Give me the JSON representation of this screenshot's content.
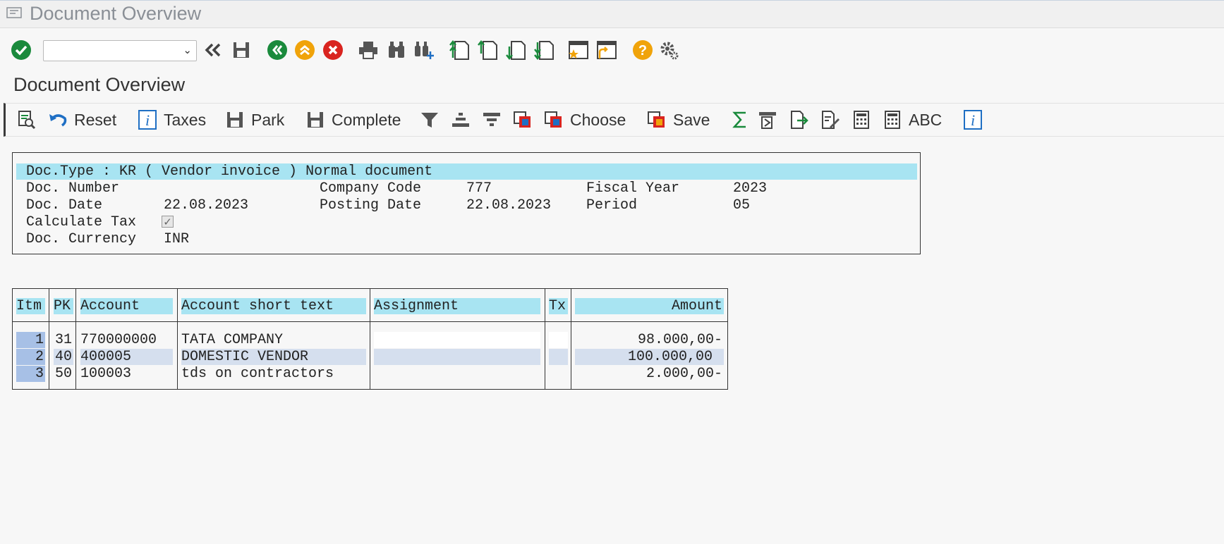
{
  "window": {
    "title": "Document Overview"
  },
  "toolbar": {
    "command_field": {
      "value": "",
      "placeholder": ""
    },
    "icons": [
      "enter-icon",
      "back-icon",
      "save-icon",
      "back-green-icon",
      "exit-icon",
      "cancel-icon",
      "print-icon",
      "find-icon",
      "find-next-icon",
      "first-page-icon",
      "previous-page-icon",
      "next-page-icon",
      "last-page-icon",
      "new-session-icon",
      "shortcut-icon",
      "help-icon",
      "settings-icon"
    ]
  },
  "page": {
    "subtitle": "Document Overview"
  },
  "app_toolbar": {
    "reset": "Reset",
    "taxes": "Taxes",
    "park": "Park",
    "complete": "Complete",
    "choose": "Choose",
    "save": "Save",
    "abc": "ABC"
  },
  "header": {
    "doc_type_line": "Doc.Type : KR ( Vendor invoice ) Normal document",
    "doc_number_label": "Doc. Number",
    "doc_number": "",
    "company_code_label": "Company Code",
    "company_code": "777",
    "fiscal_year_label": "Fiscal Year",
    "fiscal_year": "2023",
    "doc_date_label": "Doc. Date",
    "doc_date": "22.08.2023",
    "posting_date_label": "Posting Date",
    "posting_date": "22.08.2023",
    "period_label": "Period",
    "period": "05",
    "calc_tax_label": "Calculate Tax",
    "calc_tax_checked": true,
    "calc_tax_mark": "✓",
    "currency_label": "Doc. Currency",
    "currency": "INR"
  },
  "items": {
    "columns": [
      "Itm",
      "PK",
      "Account",
      "Account short text",
      "Assignment",
      "Tx",
      "Amount"
    ],
    "rows": [
      {
        "itm": "1",
        "pk": "31",
        "account": "770000000",
        "text": "TATA COMPANY",
        "assignment": "",
        "tx": "",
        "amount": "98.000,00-"
      },
      {
        "itm": "2",
        "pk": "40",
        "account": "400005",
        "text": "DOMESTIC VENDOR",
        "assignment": "",
        "tx": "",
        "amount": "100.000,00"
      },
      {
        "itm": "3",
        "pk": "50",
        "account": "100003",
        "text": "tds on contractors",
        "assignment": "",
        "tx": "",
        "amount": "2.000,00-"
      }
    ]
  },
  "colors": {
    "header_band": "#a8e4f2",
    "selected_row": "#d5dfee",
    "item_cell": "#a7c0e6",
    "green": "#1a8a3c",
    "orange": "#f0a30a",
    "red": "#d9241f",
    "blue": "#1f6fc4"
  }
}
